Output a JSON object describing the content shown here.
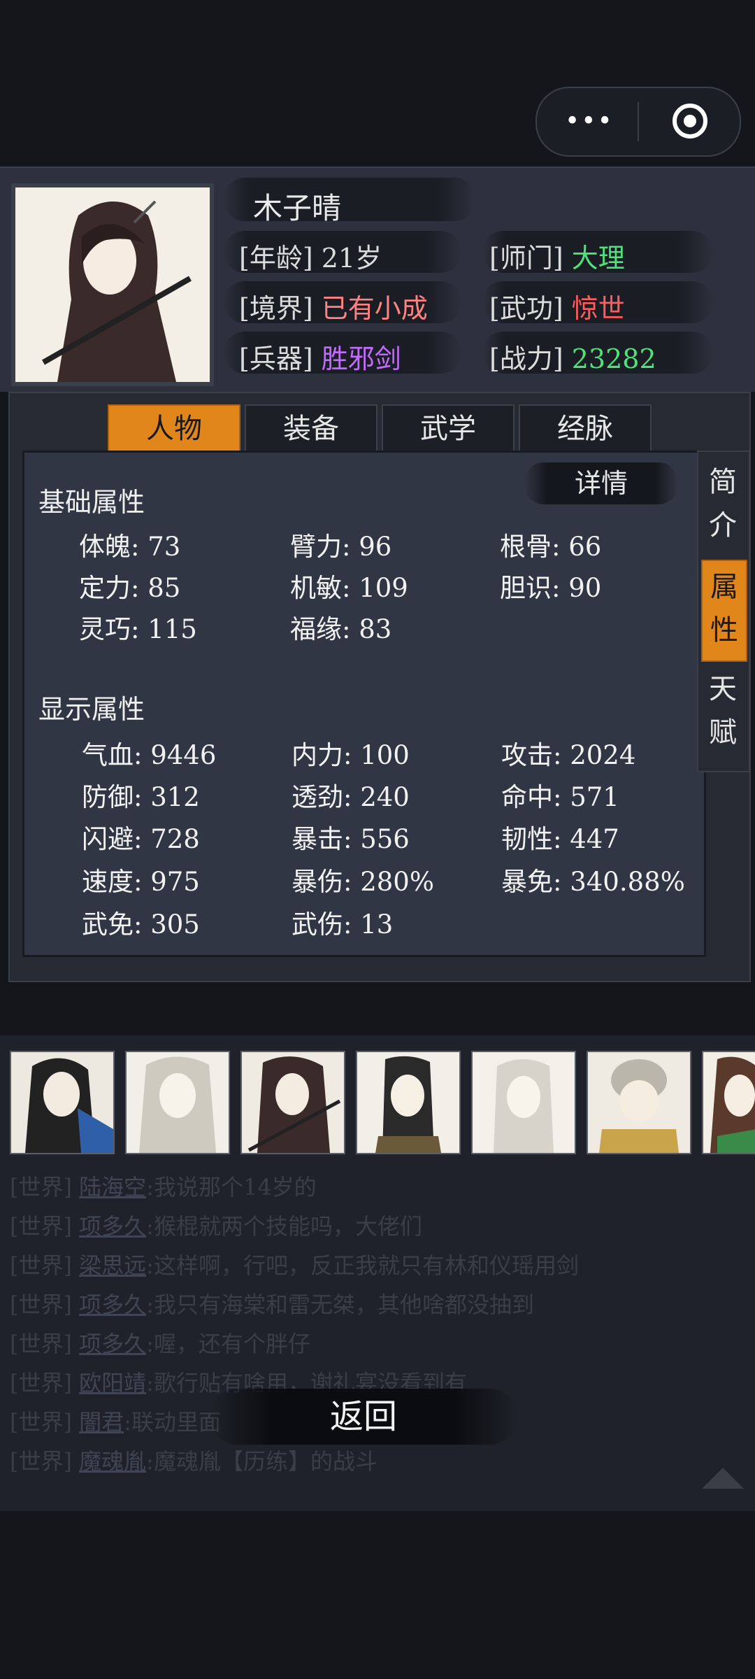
{
  "capsule": {
    "more_icon": "more-dots-icon",
    "close_icon": "target-icon",
    "more_glyph": "•••"
  },
  "character": {
    "name": "木子晴",
    "age_label": "[年龄]",
    "age_value": "21岁",
    "sect_label": "[师门]",
    "sect_value": "大理",
    "realm_label": "[境界]",
    "realm_value": "已有小成",
    "martial_label": "[武功]",
    "martial_value": "惊世",
    "weapon_label": "[兵器]",
    "weapon_value": "胜邪剑",
    "power_label": "[战力]",
    "power_value": "23282"
  },
  "tabs": [
    {
      "label": "人物",
      "active": true
    },
    {
      "label": "装备",
      "active": false
    },
    {
      "label": "武学",
      "active": false
    },
    {
      "label": "经脉",
      "active": false
    }
  ],
  "side_tabs": [
    {
      "label": "简介",
      "active": false
    },
    {
      "label": "属性",
      "active": true
    },
    {
      "label": "天赋",
      "active": false
    }
  ],
  "details_label": "详情",
  "basic": {
    "title": "基础属性",
    "rows": [
      [
        "体魄: 73",
        "臂力: 96",
        "根骨: 66"
      ],
      [
        "定力: 85",
        "机敏: 109",
        "胆识: 90"
      ],
      [
        "灵巧: 115",
        "福缘: 83",
        ""
      ]
    ]
  },
  "display": {
    "title": "显示属性",
    "rows": [
      [
        "气血: 9446",
        "内力: 100",
        "攻击: 2024"
      ],
      [
        "防御: 312",
        "透劲: 240",
        "命中: 571"
      ],
      [
        "闪避: 728",
        "暴击: 556",
        "韧性: 447"
      ],
      [
        "速度: 975",
        "暴伤: 280%",
        "暴免: 340.88%"
      ],
      [
        "武免: 305",
        "武伤: 13",
        ""
      ]
    ]
  },
  "chat": [
    {
      "channel": "[世界]",
      "name": "陆海空",
      "msg": ":我说那个14岁的"
    },
    {
      "channel": "[世界]",
      "name": "项多久",
      "msg": ":猴棍就两个技能吗，大佬们"
    },
    {
      "channel": "[世界]",
      "name": "梁思远",
      "msg": ":这样啊，行吧，反正我就只有林和仪瑶用剑"
    },
    {
      "channel": "[世界]",
      "name": "项多久",
      "msg": ":我只有海棠和雷无桀，其他啥都没抽到"
    },
    {
      "channel": "[世界]",
      "name": "项多久",
      "msg": ":喔，还有个胖仔"
    },
    {
      "channel": "[世界]",
      "name": "欧阳靖",
      "msg": ":歌行贴有啥用，谢礼宴没看到有"
    },
    {
      "channel": "[世界]",
      "name": "闇君",
      "msg": ":联动里面"
    },
    {
      "channel": "[世界]",
      "name": "魔魂胤",
      "msg": ":魔魂胤【历练】的战斗"
    }
  ],
  "back_label": "返回"
}
